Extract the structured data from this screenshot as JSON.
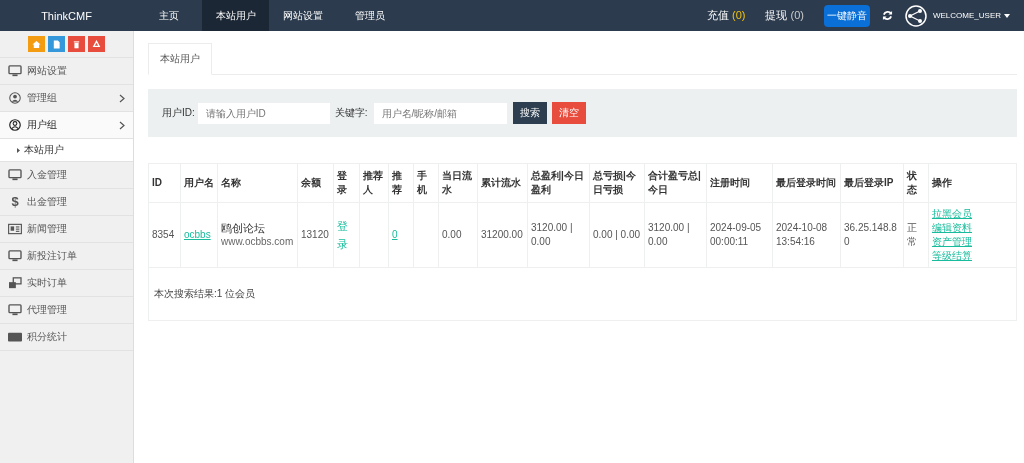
{
  "brand": "ThinkCMF",
  "nav": [
    {
      "label": "主页",
      "selected": false
    },
    {
      "label": "本站用户",
      "selected": true
    },
    {
      "label": "网站设置",
      "selected": false
    },
    {
      "label": "管理员",
      "selected": false
    }
  ],
  "header_right": {
    "recharge": {
      "label": "充值",
      "count": "(0)"
    },
    "withdraw": {
      "label": "提现",
      "count": "(0)"
    },
    "mute_button": "一键静音",
    "user": "WELCOME_USER"
  },
  "sidebar": {
    "quick_buttons": [
      {
        "kind": "home",
        "color": "#f39c12"
      },
      {
        "kind": "file",
        "color": "#3498db"
      },
      {
        "kind": "trash",
        "color": "#e74c3c"
      },
      {
        "kind": "recycle",
        "color": "#e74c3c"
      }
    ],
    "items": [
      {
        "label": "网站设置",
        "kind": "monitor",
        "arrow": false,
        "expanded": false
      },
      {
        "label": "管理组",
        "kind": "person",
        "arrow": true,
        "expanded": false
      },
      {
        "label": "用户组",
        "kind": "person_outline",
        "arrow": true,
        "expanded": true,
        "children": [
          {
            "label": "本站用户"
          }
        ]
      },
      {
        "label": "入金管理",
        "kind": "monitor",
        "arrow": false,
        "expanded": false
      },
      {
        "label": "出金管理",
        "kind": "glyph",
        "glyph": "$",
        "arrow": false,
        "expanded": false
      },
      {
        "label": "新闻管理",
        "kind": "news",
        "arrow": false,
        "expanded": false
      },
      {
        "label": "新投注订单",
        "kind": "monitor",
        "arrow": false,
        "expanded": false
      },
      {
        "label": "实时订单",
        "kind": "windows",
        "arrow": false,
        "expanded": false
      },
      {
        "label": "代理管理",
        "kind": "monitor",
        "arrow": false,
        "expanded": false
      },
      {
        "label": "积分统计",
        "kind": "card",
        "arrow": false,
        "expanded": false
      }
    ]
  },
  "tabs": [
    {
      "label": "本站用户",
      "selected": true
    }
  ],
  "search": {
    "user_id_label": "用户ID:",
    "user_id_placeholder": "请输入用户ID",
    "keyword_label": "关键字:",
    "keyword_placeholder": "用户名/昵称/邮箱",
    "search_button": "搜索",
    "clear_button": "清空"
  },
  "table": {
    "columns": [
      "ID",
      "用户名",
      "名称",
      "余额",
      "登录",
      "推荐人",
      "推荐",
      "手机",
      "当日流水",
      "累计流水",
      "总盈利|今日盈利",
      "总亏损|今日亏损",
      "合计盈亏总|今日",
      "注册时间",
      "最后登录时间",
      "最后登录IP",
      "状态",
      "操作"
    ],
    "rows": [
      {
        "cells": [
          {
            "kind": "text",
            "text": "8354"
          },
          {
            "kind": "link",
            "text": "ocbbs"
          },
          {
            "kind": "two_line",
            "title": "鸥创论坛",
            "subtitle": "www.ocbbs.com"
          },
          {
            "kind": "text",
            "text": "13120"
          },
          {
            "kind": "plain_link",
            "text": "登录"
          },
          {
            "kind": "text",
            "text": ""
          },
          {
            "kind": "link",
            "text": "0"
          },
          {
            "kind": "text",
            "text": ""
          },
          {
            "kind": "text",
            "text": "0.00"
          },
          {
            "kind": "text",
            "text": "31200.00"
          },
          {
            "kind": "text",
            "text": "3120.00 | 0.00"
          },
          {
            "kind": "text",
            "text": "0.00 | 0.00"
          },
          {
            "kind": "text",
            "text": "3120.00 | 0.00"
          },
          {
            "kind": "text",
            "text": "2024-09-05 00:00:11"
          },
          {
            "kind": "text",
            "text": "2024-10-08 13:54:16"
          },
          {
            "kind": "text",
            "text": "36.25.148.80"
          },
          {
            "kind": "text",
            "text": "正常"
          },
          {
            "kind": "links",
            "links": [
              "拉黑会员",
              "编辑资料",
              "资产管理",
              "等级结算"
            ]
          }
        ]
      }
    ],
    "summary": "本次搜索结果:1 位会员"
  }
}
